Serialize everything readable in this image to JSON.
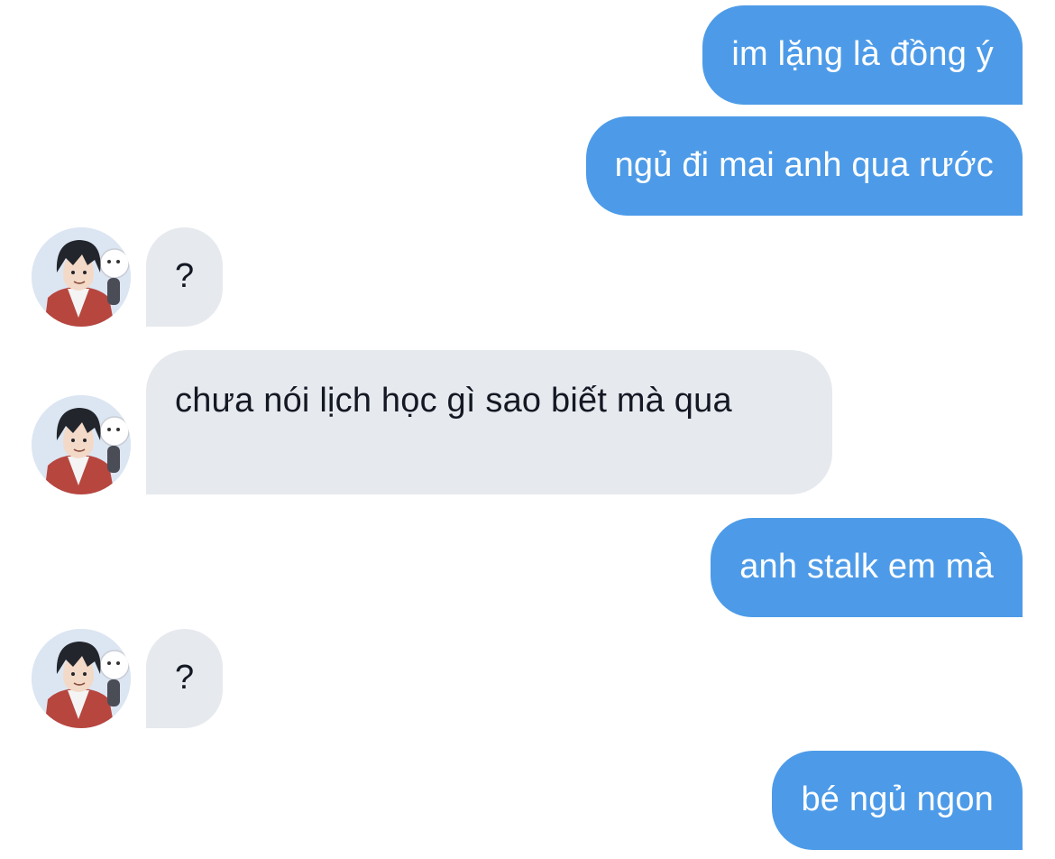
{
  "messages": [
    {
      "direction": "outgoing",
      "text": "im lặng là đồng ý"
    },
    {
      "direction": "outgoing",
      "text": "ngủ đi mai anh qua rước"
    },
    {
      "direction": "incoming",
      "text": "?",
      "avatar": "user-avatar"
    },
    {
      "direction": "incoming",
      "text": "chưa nói lịch học gì sao biết mà qua",
      "avatar": "user-avatar"
    },
    {
      "direction": "outgoing",
      "text": "anh stalk em mà"
    },
    {
      "direction": "incoming",
      "text": "?",
      "avatar": "user-avatar"
    },
    {
      "direction": "outgoing",
      "text": "bé ngủ ngon"
    }
  ],
  "colors": {
    "outgoing_bubble": "#4d9be8",
    "incoming_bubble": "#e6e9ee",
    "outgoing_text": "#ffffff",
    "incoming_text": "#141823",
    "background": "#ffffff"
  }
}
